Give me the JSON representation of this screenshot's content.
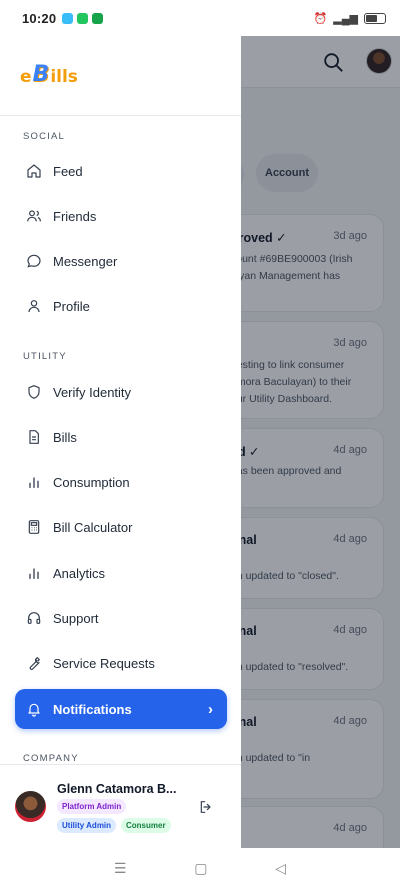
{
  "status_bar": {
    "time": "10:20"
  },
  "logo": {
    "e": "e",
    "b": "B",
    "ills": "ills"
  },
  "sections": {
    "social": "SOCIAL",
    "utility": "UTILITY",
    "company": "COMPANY"
  },
  "nav": {
    "feed": "Feed",
    "friends": "Friends",
    "messenger": "Messenger",
    "profile": "Profile",
    "verify_identity": "Verify Identity",
    "bills": "Bills",
    "consumption": "Consumption",
    "bill_calculator": "Bill Calculator",
    "analytics": "Analytics",
    "support": "Support",
    "service_requests": "Service Requests",
    "notifications": "Notifications"
  },
  "user": {
    "name": "Glenn Catamora B...",
    "badges": {
      "platform_admin": "Platform Admin",
      "utility_admin": "Utility Admin",
      "consumer": "Consumer"
    }
  },
  "background": {
    "chip_account": "Account",
    "cards": [
      {
        "title": "proved ✓",
        "time": "3d ago",
        "body": "count #69BE900003 (Irish\nlayan Management has"
      },
      {
        "title": "t",
        "time": "3d ago",
        "body": "uesting to link consumer\namora Baculayan) to their\nour Utility Dashboard."
      },
      {
        "title": "ed ✓",
        "time": "4d ago",
        "body": "has been approved and"
      },
      {
        "title": "onal",
        "title2": "t",
        "time": "4d ago",
        "body": "en updated to \"closed\"."
      },
      {
        "title": "onal",
        "title2": "t",
        "time": "4d ago",
        "body": "en updated to \"resolved\"."
      },
      {
        "title": "onal",
        "title2": "t",
        "time": "4d ago",
        "body": "en updated to \"in"
      },
      {
        "title": "",
        "time": "4d ago",
        "body": ""
      }
    ]
  },
  "colors": {
    "accent": "#2563eb",
    "logo_orange": "#f59e0b",
    "logo_blue": "#3b82f6"
  }
}
